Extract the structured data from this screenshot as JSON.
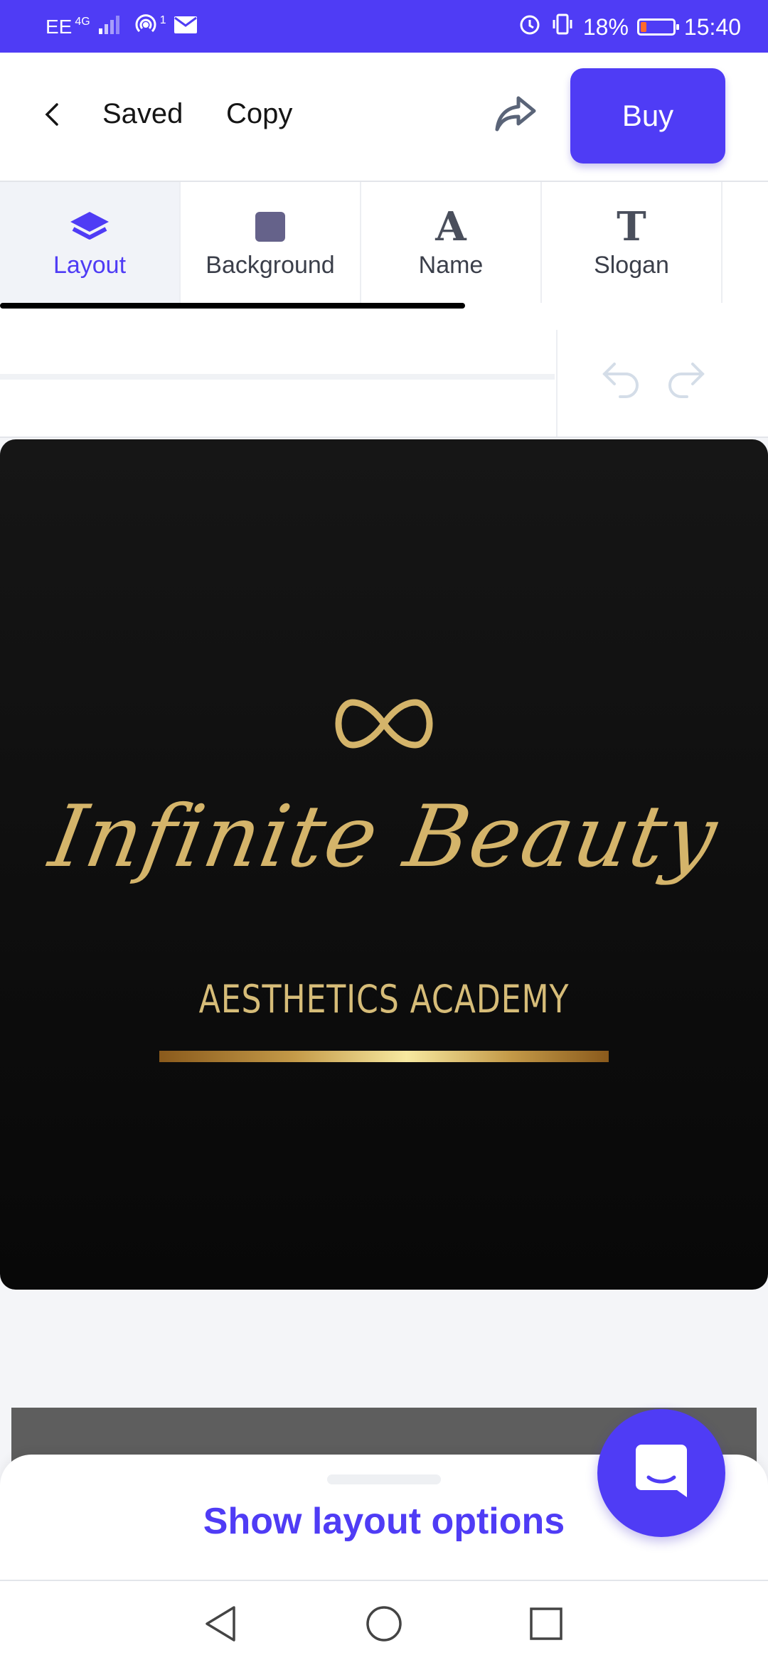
{
  "status_bar": {
    "carrier": "EE",
    "network": "4G",
    "notification_count": "1",
    "battery": "18%",
    "battery_level": 0.18,
    "time": "15:40"
  },
  "header": {
    "saved_label": "Saved",
    "copy_label": "Copy",
    "buy_label": "Buy"
  },
  "tabs": [
    {
      "label": "Layout",
      "icon": "layers-icon",
      "active": true
    },
    {
      "label": "Background",
      "icon": "square-icon",
      "active": false
    },
    {
      "label": "Name",
      "icon": "letter-a-icon",
      "active": false
    },
    {
      "label": "Slogan",
      "icon": "letter-t-icon",
      "active": false
    }
  ],
  "tab_glyphs": {
    "name": "A",
    "slogan": "T"
  },
  "logo": {
    "name": "Infinite Beauty",
    "slogan": "AESTHETICS ACADEMY",
    "accent_color": "#d4b46a"
  },
  "bottom_sheet": {
    "button_label": "Show layout options"
  },
  "colors": {
    "brand": "#4f3cf5",
    "canvas_bg": "#111111"
  }
}
